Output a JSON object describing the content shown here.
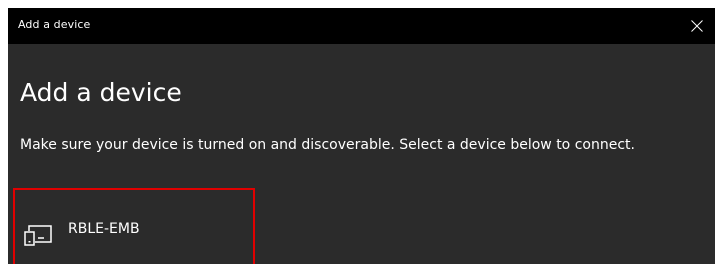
{
  "window": {
    "title": "Add a device"
  },
  "main": {
    "heading": "Add a device",
    "description": "Make sure your device is turned on and discoverable. Select a device below to connect."
  },
  "devices": [
    {
      "name": "RBLE-EMB",
      "icon": "computer-device-icon"
    }
  ],
  "colors": {
    "titlebar": "#000000",
    "background": "#2b2b2b",
    "text": "#ffffff",
    "highlight_border": "#e00000"
  },
  "icons": {
    "close": "close-icon"
  }
}
